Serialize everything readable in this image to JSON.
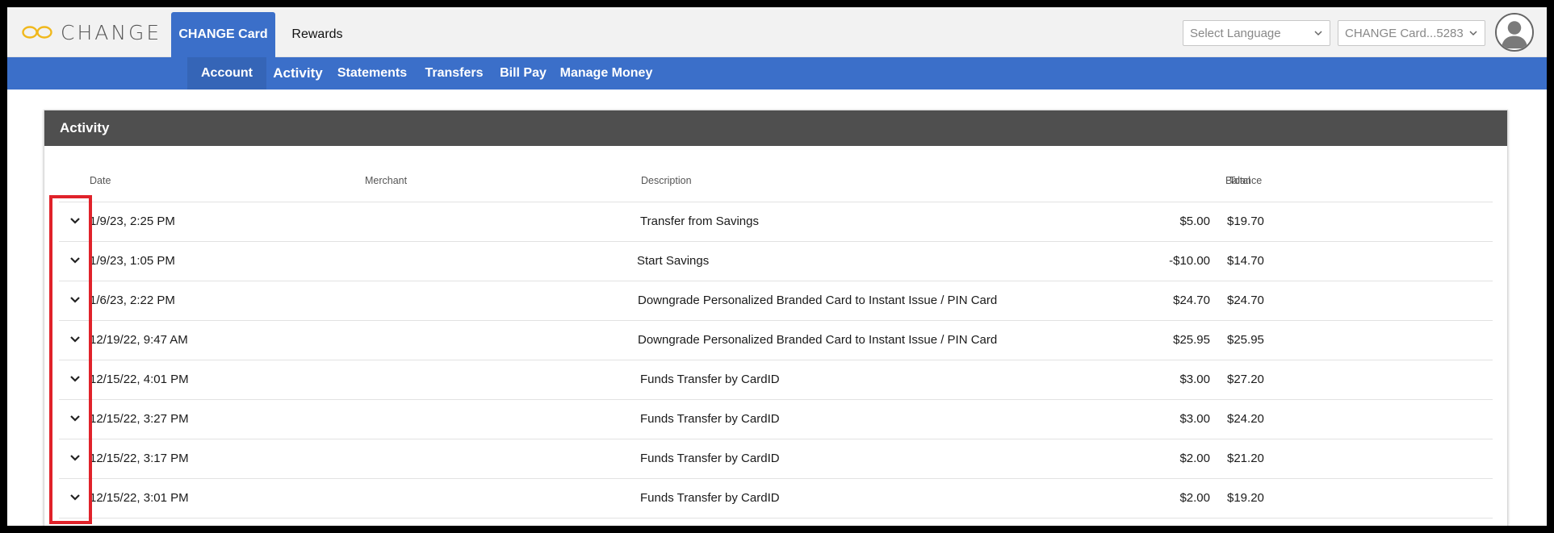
{
  "header": {
    "logo_text": "CHANGE",
    "tabs": [
      {
        "label": "CHANGE Card",
        "active": true
      },
      {
        "label": "Rewards",
        "active": false
      }
    ],
    "language_select": {
      "value": "Select Language"
    },
    "card_select": {
      "value": "CHANGE Card...5283"
    }
  },
  "nav": {
    "items": [
      {
        "label": "Account"
      },
      {
        "label": "Activity",
        "active": true
      },
      {
        "label": "Statements"
      },
      {
        "label": "Transfers"
      },
      {
        "label": "Bill Pay"
      },
      {
        "label": "Manage Money"
      }
    ]
  },
  "panel": {
    "title": "Activity",
    "columns": {
      "date": "Date",
      "merchant": "Merchant",
      "description": "Description",
      "total": "Total",
      "balance": "Balance"
    },
    "rows": [
      {
        "date": "1/9/23, 2:25 PM",
        "merchant": "",
        "description": "Transfer from Savings",
        "total": "$5.00",
        "balance": "$19.70"
      },
      {
        "date": "1/9/23, 1:05 PM",
        "merchant": "",
        "description": "Start Savings",
        "total": "-$10.00",
        "balance": "$14.70"
      },
      {
        "date": "1/6/23, 2:22 PM",
        "merchant": "",
        "description": "Downgrade Personalized Branded Card to Instant Issue / PIN Card",
        "total": "$24.70",
        "balance": "$24.70"
      },
      {
        "date": "12/19/22, 9:47 AM",
        "merchant": "",
        "description": "Downgrade Personalized Branded Card to Instant Issue / PIN Card",
        "total": "$25.95",
        "balance": "$25.95"
      },
      {
        "date": "12/15/22, 4:01 PM",
        "merchant": "",
        "description": "Funds Transfer by CardID",
        "total": "$3.00",
        "balance": "$27.20"
      },
      {
        "date": "12/15/22, 3:27 PM",
        "merchant": "",
        "description": "Funds Transfer by CardID",
        "total": "$3.00",
        "balance": "$24.20"
      },
      {
        "date": "12/15/22, 3:17 PM",
        "merchant": "",
        "description": "Funds Transfer by CardID",
        "total": "$2.00",
        "balance": "$21.20"
      },
      {
        "date": "12/15/22, 3:01 PM",
        "merchant": "",
        "description": "Funds Transfer by CardID",
        "total": "$2.00",
        "balance": "$19.20"
      }
    ]
  },
  "colors": {
    "brand_blue": "#3b6fc9",
    "panel_header": "#4f4f4f",
    "logo_gold": "#f0b81c",
    "highlight_red": "#e0222a"
  }
}
